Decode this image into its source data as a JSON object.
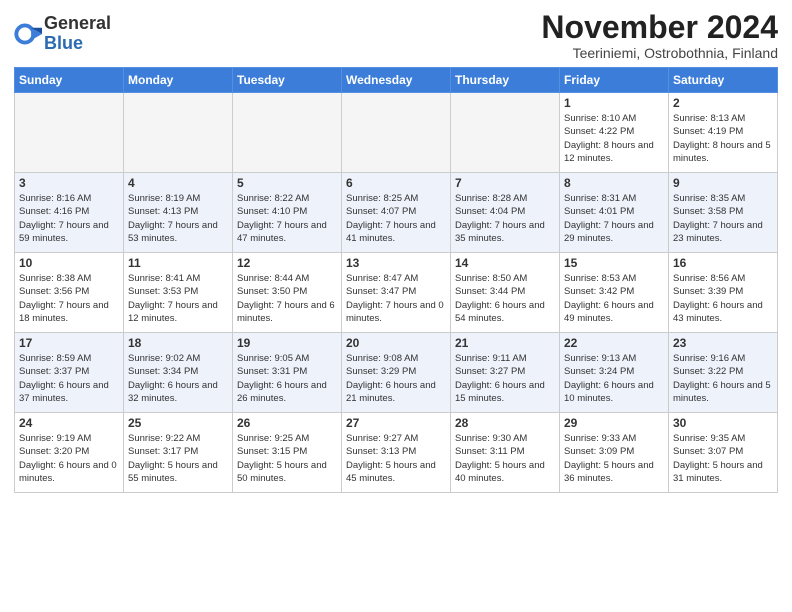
{
  "logo": {
    "general": "General",
    "blue": "Blue"
  },
  "header": {
    "month": "November 2024",
    "location": "Teeriniemi, Ostrobothnia, Finland"
  },
  "days_of_week": [
    "Sunday",
    "Monday",
    "Tuesday",
    "Wednesday",
    "Thursday",
    "Friday",
    "Saturday"
  ],
  "weeks": [
    [
      {
        "day": "",
        "info": ""
      },
      {
        "day": "",
        "info": ""
      },
      {
        "day": "",
        "info": ""
      },
      {
        "day": "",
        "info": ""
      },
      {
        "day": "",
        "info": ""
      },
      {
        "day": "1",
        "info": "Sunrise: 8:10 AM\nSunset: 4:22 PM\nDaylight: 8 hours and 12 minutes."
      },
      {
        "day": "2",
        "info": "Sunrise: 8:13 AM\nSunset: 4:19 PM\nDaylight: 8 hours and 5 minutes."
      }
    ],
    [
      {
        "day": "3",
        "info": "Sunrise: 8:16 AM\nSunset: 4:16 PM\nDaylight: 7 hours and 59 minutes."
      },
      {
        "day": "4",
        "info": "Sunrise: 8:19 AM\nSunset: 4:13 PM\nDaylight: 7 hours and 53 minutes."
      },
      {
        "day": "5",
        "info": "Sunrise: 8:22 AM\nSunset: 4:10 PM\nDaylight: 7 hours and 47 minutes."
      },
      {
        "day": "6",
        "info": "Sunrise: 8:25 AM\nSunset: 4:07 PM\nDaylight: 7 hours and 41 minutes."
      },
      {
        "day": "7",
        "info": "Sunrise: 8:28 AM\nSunset: 4:04 PM\nDaylight: 7 hours and 35 minutes."
      },
      {
        "day": "8",
        "info": "Sunrise: 8:31 AM\nSunset: 4:01 PM\nDaylight: 7 hours and 29 minutes."
      },
      {
        "day": "9",
        "info": "Sunrise: 8:35 AM\nSunset: 3:58 PM\nDaylight: 7 hours and 23 minutes."
      }
    ],
    [
      {
        "day": "10",
        "info": "Sunrise: 8:38 AM\nSunset: 3:56 PM\nDaylight: 7 hours and 18 minutes."
      },
      {
        "day": "11",
        "info": "Sunrise: 8:41 AM\nSunset: 3:53 PM\nDaylight: 7 hours and 12 minutes."
      },
      {
        "day": "12",
        "info": "Sunrise: 8:44 AM\nSunset: 3:50 PM\nDaylight: 7 hours and 6 minutes."
      },
      {
        "day": "13",
        "info": "Sunrise: 8:47 AM\nSunset: 3:47 PM\nDaylight: 7 hours and 0 minutes."
      },
      {
        "day": "14",
        "info": "Sunrise: 8:50 AM\nSunset: 3:44 PM\nDaylight: 6 hours and 54 minutes."
      },
      {
        "day": "15",
        "info": "Sunrise: 8:53 AM\nSunset: 3:42 PM\nDaylight: 6 hours and 49 minutes."
      },
      {
        "day": "16",
        "info": "Sunrise: 8:56 AM\nSunset: 3:39 PM\nDaylight: 6 hours and 43 minutes."
      }
    ],
    [
      {
        "day": "17",
        "info": "Sunrise: 8:59 AM\nSunset: 3:37 PM\nDaylight: 6 hours and 37 minutes."
      },
      {
        "day": "18",
        "info": "Sunrise: 9:02 AM\nSunset: 3:34 PM\nDaylight: 6 hours and 32 minutes."
      },
      {
        "day": "19",
        "info": "Sunrise: 9:05 AM\nSunset: 3:31 PM\nDaylight: 6 hours and 26 minutes."
      },
      {
        "day": "20",
        "info": "Sunrise: 9:08 AM\nSunset: 3:29 PM\nDaylight: 6 hours and 21 minutes."
      },
      {
        "day": "21",
        "info": "Sunrise: 9:11 AM\nSunset: 3:27 PM\nDaylight: 6 hours and 15 minutes."
      },
      {
        "day": "22",
        "info": "Sunrise: 9:13 AM\nSunset: 3:24 PM\nDaylight: 6 hours and 10 minutes."
      },
      {
        "day": "23",
        "info": "Sunrise: 9:16 AM\nSunset: 3:22 PM\nDaylight: 6 hours and 5 minutes."
      }
    ],
    [
      {
        "day": "24",
        "info": "Sunrise: 9:19 AM\nSunset: 3:20 PM\nDaylight: 6 hours and 0 minutes."
      },
      {
        "day": "25",
        "info": "Sunrise: 9:22 AM\nSunset: 3:17 PM\nDaylight: 5 hours and 55 minutes."
      },
      {
        "day": "26",
        "info": "Sunrise: 9:25 AM\nSunset: 3:15 PM\nDaylight: 5 hours and 50 minutes."
      },
      {
        "day": "27",
        "info": "Sunrise: 9:27 AM\nSunset: 3:13 PM\nDaylight: 5 hours and 45 minutes."
      },
      {
        "day": "28",
        "info": "Sunrise: 9:30 AM\nSunset: 3:11 PM\nDaylight: 5 hours and 40 minutes."
      },
      {
        "day": "29",
        "info": "Sunrise: 9:33 AM\nSunset: 3:09 PM\nDaylight: 5 hours and 36 minutes."
      },
      {
        "day": "30",
        "info": "Sunrise: 9:35 AM\nSunset: 3:07 PM\nDaylight: 5 hours and 31 minutes."
      }
    ]
  ]
}
